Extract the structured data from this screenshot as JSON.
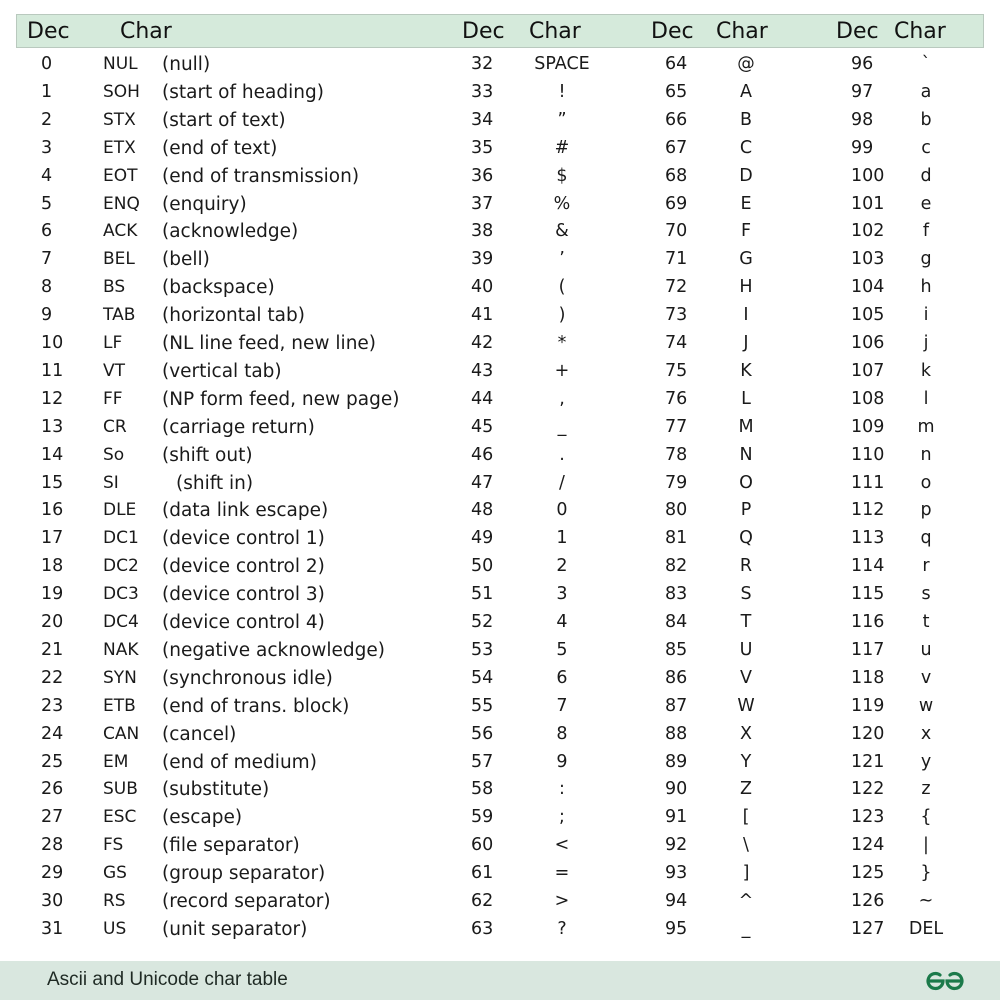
{
  "header": {
    "columns": [
      {
        "dec": "Dec",
        "char": "Char"
      },
      {
        "dec": "Dec",
        "char": "Char"
      },
      {
        "dec": "Dec",
        "char": "Char"
      },
      {
        "dec": "Dec",
        "char": "Char"
      }
    ]
  },
  "control_chars": [
    {
      "dec": "0",
      "abbr": "NUL",
      "desc": "(null)"
    },
    {
      "dec": "1",
      "abbr": "SOH",
      "desc": "(start of heading)"
    },
    {
      "dec": "2",
      "abbr": "STX",
      "desc": "(start of text)"
    },
    {
      "dec": "3",
      "abbr": "ETX",
      "desc": "(end of text)"
    },
    {
      "dec": "4",
      "abbr": "EOT",
      "desc": "(end of transmission)"
    },
    {
      "dec": "5",
      "abbr": "ENQ",
      "desc": "(enquiry)"
    },
    {
      "dec": "6",
      "abbr": "ACK",
      "desc": "(acknowledge)"
    },
    {
      "dec": "7",
      "abbr": "BEL",
      "desc": "(bell)"
    },
    {
      "dec": "8",
      "abbr": "BS",
      "desc": "(backspace)"
    },
    {
      "dec": "9",
      "abbr": "TAB",
      "desc": "(horizontal tab)"
    },
    {
      "dec": "10",
      "abbr": "LF",
      "desc": "(NL line feed, new line)"
    },
    {
      "dec": "11",
      "abbr": "VT",
      "desc": "(vertical tab)"
    },
    {
      "dec": "12",
      "abbr": "FF",
      "desc": "(NP form feed, new page)"
    },
    {
      "dec": "13",
      "abbr": "CR",
      "desc": "(carriage return)"
    },
    {
      "dec": "14",
      "abbr": "So",
      "desc": "(shift out)"
    },
    {
      "dec": "15",
      "abbr": "SI",
      "desc": "(shift in)"
    },
    {
      "dec": "16",
      "abbr": "DLE",
      "desc": "(data link escape)"
    },
    {
      "dec": "17",
      "abbr": "DC1",
      "desc": "(device control 1)"
    },
    {
      "dec": "18",
      "abbr": "DC2",
      "desc": "(device control 2)"
    },
    {
      "dec": "19",
      "abbr": "DC3",
      "desc": "(device control 3)"
    },
    {
      "dec": "20",
      "abbr": "DC4",
      "desc": "(device control 4)"
    },
    {
      "dec": "21",
      "abbr": "NAK",
      "desc": "(negative acknowledge)"
    },
    {
      "dec": "22",
      "abbr": "SYN",
      "desc": "(synchronous idle)"
    },
    {
      "dec": "23",
      "abbr": "ETB",
      "desc": "(end of trans. block)"
    },
    {
      "dec": "24",
      "abbr": "CAN",
      "desc": "(cancel)"
    },
    {
      "dec": "25",
      "abbr": "EM",
      "desc": "(end of medium)"
    },
    {
      "dec": "26",
      "abbr": "SUB",
      "desc": "(substitute)"
    },
    {
      "dec": "27",
      "abbr": "ESC",
      "desc": "(escape)"
    },
    {
      "dec": "28",
      "abbr": "FS",
      "desc": "(file separator)"
    },
    {
      "dec": "29",
      "abbr": "GS",
      "desc": "(group separator)"
    },
    {
      "dec": "30",
      "abbr": "RS",
      "desc": "(record separator)"
    },
    {
      "dec": "31",
      "abbr": "US",
      "desc": "(unit separator)"
    }
  ],
  "col2": [
    {
      "dec": "32",
      "char": "SPACE"
    },
    {
      "dec": "33",
      "char": "!"
    },
    {
      "dec": "34",
      "char": "”"
    },
    {
      "dec": "35",
      "char": "#"
    },
    {
      "dec": "36",
      "char": "$"
    },
    {
      "dec": "37",
      "char": "%"
    },
    {
      "dec": "38",
      "char": "&"
    },
    {
      "dec": "39",
      "char": "’"
    },
    {
      "dec": "40",
      "char": "("
    },
    {
      "dec": "41",
      "char": ")"
    },
    {
      "dec": "42",
      "char": "*"
    },
    {
      "dec": "43",
      "char": "+"
    },
    {
      "dec": "44",
      "char": ","
    },
    {
      "dec": "45",
      "char": "_"
    },
    {
      "dec": "46",
      "char": "."
    },
    {
      "dec": "47",
      "char": "/"
    },
    {
      "dec": "48",
      "char": "0"
    },
    {
      "dec": "49",
      "char": "1"
    },
    {
      "dec": "50",
      "char": "2"
    },
    {
      "dec": "51",
      "char": "3"
    },
    {
      "dec": "52",
      "char": "4"
    },
    {
      "dec": "53",
      "char": "5"
    },
    {
      "dec": "54",
      "char": "6"
    },
    {
      "dec": "55",
      "char": "7"
    },
    {
      "dec": "56",
      "char": "8"
    },
    {
      "dec": "57",
      "char": "9"
    },
    {
      "dec": "58",
      "char": ":"
    },
    {
      "dec": "59",
      "char": ";"
    },
    {
      "dec": "60",
      "char": "<"
    },
    {
      "dec": "61",
      "char": "="
    },
    {
      "dec": "62",
      "char": ">"
    },
    {
      "dec": "63",
      "char": "?"
    }
  ],
  "col3": [
    {
      "dec": "64",
      "char": "@"
    },
    {
      "dec": "65",
      "char": "A"
    },
    {
      "dec": "66",
      "char": "B"
    },
    {
      "dec": "67",
      "char": "C"
    },
    {
      "dec": "68",
      "char": "D"
    },
    {
      "dec": "69",
      "char": "E"
    },
    {
      "dec": "70",
      "char": "F"
    },
    {
      "dec": "71",
      "char": "G"
    },
    {
      "dec": "72",
      "char": "H"
    },
    {
      "dec": "73",
      "char": "I"
    },
    {
      "dec": "74",
      "char": "J"
    },
    {
      "dec": "75",
      "char": "K"
    },
    {
      "dec": "76",
      "char": "L"
    },
    {
      "dec": "77",
      "char": "M"
    },
    {
      "dec": "78",
      "char": "N"
    },
    {
      "dec": "79",
      "char": "O"
    },
    {
      "dec": "80",
      "char": "P"
    },
    {
      "dec": "81",
      "char": "Q"
    },
    {
      "dec": "82",
      "char": "R"
    },
    {
      "dec": "83",
      "char": "S"
    },
    {
      "dec": "84",
      "char": "T"
    },
    {
      "dec": "85",
      "char": "U"
    },
    {
      "dec": "86",
      "char": "V"
    },
    {
      "dec": "87",
      "char": "W"
    },
    {
      "dec": "88",
      "char": "X"
    },
    {
      "dec": "89",
      "char": "Y"
    },
    {
      "dec": "90",
      "char": "Z"
    },
    {
      "dec": "91",
      "char": "["
    },
    {
      "dec": "92",
      "char": "\\"
    },
    {
      "dec": "93",
      "char": "]"
    },
    {
      "dec": "94",
      "char": "^"
    },
    {
      "dec": "95",
      "char": "_"
    }
  ],
  "col4": [
    {
      "dec": "96",
      "char": "`"
    },
    {
      "dec": "97",
      "char": "a"
    },
    {
      "dec": "98",
      "char": "b"
    },
    {
      "dec": "99",
      "char": "c"
    },
    {
      "dec": "100",
      "char": "d"
    },
    {
      "dec": "101",
      "char": "e"
    },
    {
      "dec": "102",
      "char": "f"
    },
    {
      "dec": "103",
      "char": "g"
    },
    {
      "dec": "104",
      "char": "h"
    },
    {
      "dec": "105",
      "char": "i"
    },
    {
      "dec": "106",
      "char": "j"
    },
    {
      "dec": "107",
      "char": "k"
    },
    {
      "dec": "108",
      "char": "l"
    },
    {
      "dec": "109",
      "char": "m"
    },
    {
      "dec": "110",
      "char": "n"
    },
    {
      "dec": "111",
      "char": "o"
    },
    {
      "dec": "112",
      "char": "p"
    },
    {
      "dec": "113",
      "char": "q"
    },
    {
      "dec": "114",
      "char": "r"
    },
    {
      "dec": "115",
      "char": "s"
    },
    {
      "dec": "116",
      "char": "t"
    },
    {
      "dec": "117",
      "char": "u"
    },
    {
      "dec": "118",
      "char": "v"
    },
    {
      "dec": "119",
      "char": "w"
    },
    {
      "dec": "120",
      "char": "x"
    },
    {
      "dec": "121",
      "char": "y"
    },
    {
      "dec": "122",
      "char": "z"
    },
    {
      "dec": "123",
      "char": "{"
    },
    {
      "dec": "124",
      "char": "|"
    },
    {
      "dec": "125",
      "char": "}"
    },
    {
      "dec": "126",
      "char": "~"
    },
    {
      "dec": "127",
      "char": "DEL"
    }
  ],
  "footer": {
    "title": "Ascii and Unicode char table",
    "logo": "geeksforgeeks-logo-icon"
  },
  "colors": {
    "header_bg": "#d5eadb",
    "footer_bg": "#d9e7df",
    "logo_green": "#1b7a4a"
  }
}
